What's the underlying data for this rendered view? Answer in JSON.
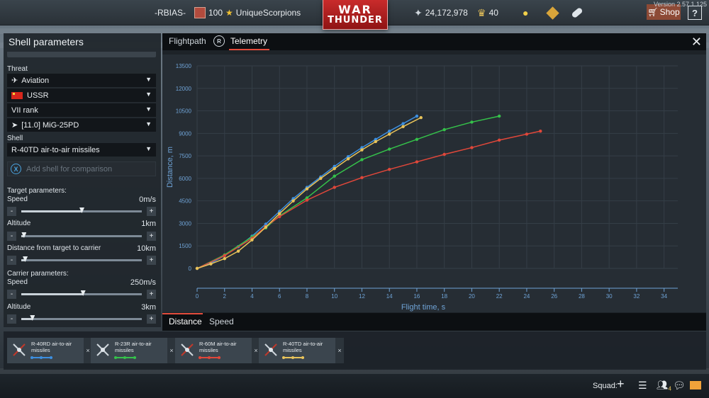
{
  "topbar": {
    "player_tag": "-RBIAS-",
    "level": "100",
    "player_name": "UniqueScorpions",
    "logo_line1": "WAR",
    "logo_line2": "THUNDER",
    "silver_lions": "24,172,978",
    "golden_eagles": "40",
    "shop_label": "Shop",
    "help_label": "?",
    "version": "Version 2.57.1.125"
  },
  "left_panel": {
    "title": "Shell parameters",
    "threat_label": "Threat",
    "threat_type": "Aviation",
    "country": "USSR",
    "rank": "VII rank",
    "aircraft": "[11.0] MiG-25PD",
    "shell_label": "Shell",
    "shell": "R-40TD air-to-air missiles",
    "add_shell_placeholder": "Add shell for comparison",
    "target_params_label": "Target parameters:",
    "target_speed_label": "Speed",
    "target_speed_value": "0m/s",
    "target_speed_fraction": 0.5,
    "target_altitude_label": "Altitude",
    "target_altitude_value": "1km",
    "target_altitude_fraction": 0.02,
    "distance_label": "Distance from target to carrier",
    "distance_value": "10km",
    "distance_fraction": 0.03,
    "carrier_params_label": "Carrier parameters:",
    "carrier_speed_label": "Speed",
    "carrier_speed_value": "250m/s",
    "carrier_speed_fraction": 0.51,
    "carrier_altitude_label": "Altitude",
    "carrier_altitude_value": "3km",
    "carrier_altitude_fraction": 0.09,
    "minus_label": "-",
    "plus_label": "+"
  },
  "main_panel": {
    "tab_flightpath": "Flightpath",
    "tab_telemetry": "Telemetry",
    "r_icon_label": "R",
    "close_label": "✕",
    "tab_distance": "Distance",
    "tab_speed": "Speed"
  },
  "chart_data": {
    "type": "line",
    "xlabel": "Flight time, s",
    "ylabel": "Distance, m",
    "xlim": [
      0,
      35
    ],
    "ylim": [
      0,
      13500
    ],
    "x_ticks": [
      0,
      2,
      4,
      6,
      8,
      10,
      12,
      14,
      16,
      18,
      20,
      22,
      24,
      26,
      28,
      30,
      32,
      34
    ],
    "y_ticks": [
      0,
      1500,
      3000,
      4500,
      6000,
      7500,
      9000,
      10500,
      12000,
      13500
    ],
    "grid": true,
    "series": [
      {
        "name": "R-40RD air-to-air missiles",
        "color": "#3d8fe0",
        "x": [
          0,
          1,
          2,
          3,
          4,
          5,
          6,
          7,
          8,
          9,
          10,
          11,
          12,
          13,
          14,
          15,
          16
        ],
        "y": [
          0,
          350,
          850,
          1450,
          2150,
          2950,
          3800,
          4650,
          5400,
          6100,
          6800,
          7450,
          8050,
          8600,
          9150,
          9650,
          10150
        ]
      },
      {
        "name": "R-23R air-to-air missiles",
        "color": "#35c24a",
        "x": [
          0,
          2,
          4,
          5,
          6,
          8,
          10,
          12,
          14,
          16,
          18,
          20,
          22
        ],
        "y": [
          0,
          900,
          2100,
          2700,
          3500,
          4700,
          6150,
          7250,
          7950,
          8600,
          9250,
          9750,
          10150
        ]
      },
      {
        "name": "R-60M air-to-air missiles",
        "color": "#e0473a",
        "x": [
          0,
          2,
          4,
          5,
          6,
          8,
          10,
          12,
          14,
          16,
          18,
          20,
          22,
          24,
          25
        ],
        "y": [
          0,
          850,
          2000,
          2800,
          3450,
          4550,
          5400,
          6050,
          6600,
          7100,
          7600,
          8050,
          8550,
          8950,
          9150
        ]
      },
      {
        "name": "R-40TD air-to-air missiles",
        "color": "#e8c35a",
        "x": [
          0,
          1,
          2,
          3,
          4,
          5,
          6,
          7,
          8,
          9,
          10,
          11,
          12,
          13,
          14,
          15,
          16.3
        ],
        "y": [
          0,
          300,
          650,
          1150,
          1900,
          2750,
          3650,
          4500,
          5300,
          6000,
          6650,
          7300,
          7900,
          8450,
          8950,
          9450,
          10050
        ]
      }
    ]
  },
  "compare": {
    "cards": [
      {
        "name": "R-40RD air-to-air missiles",
        "color": "#3d8fe0"
      },
      {
        "name": "R-23R air-to-air missiles",
        "color": "#35c24a"
      },
      {
        "name": "R-60M air-to-air missiles",
        "color": "#e0473a"
      },
      {
        "name": "R-40TD air-to-air missiles",
        "color": "#e8c35a"
      }
    ],
    "close_label": "×"
  },
  "bottombar": {
    "squad_label": "Squad:",
    "add_label": "+",
    "friends_badge": "4"
  }
}
